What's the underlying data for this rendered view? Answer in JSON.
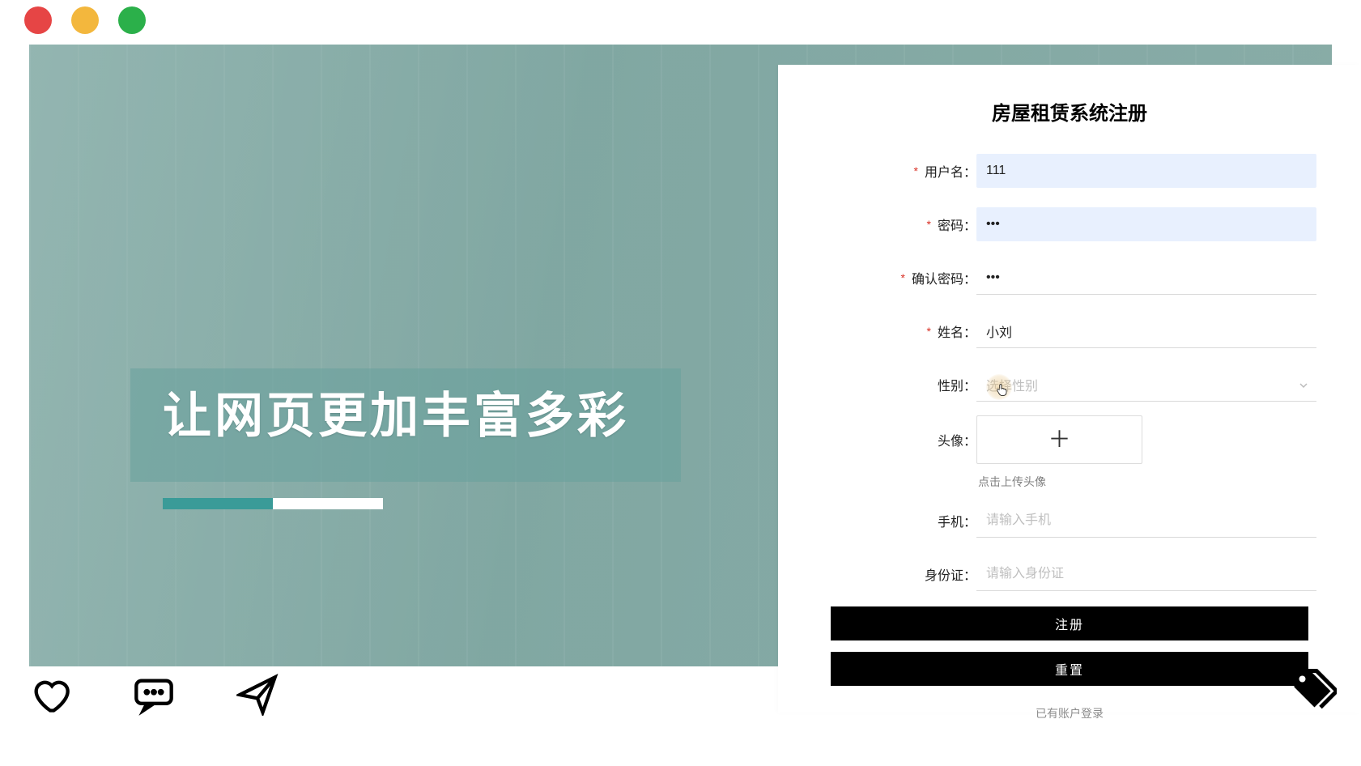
{
  "hero": {
    "headline": "让网页更加丰富多彩"
  },
  "form": {
    "title": "房屋租赁系统注册",
    "labels": {
      "username": "用户名：",
      "password": "密码：",
      "confirm": "确认密码：",
      "name": "姓名：",
      "gender": "性别：",
      "avatar": "头像：",
      "phone": "手机：",
      "idcard": "身份证："
    },
    "values": {
      "username": "111",
      "password": "•••",
      "confirm": "•••",
      "name": "小刘",
      "gender": ""
    },
    "placeholders": {
      "gender": "选择性别",
      "phone": "请输入手机",
      "idcard": "请输入身份证"
    },
    "upload_hint": "点击上传头像",
    "buttons": {
      "register": "注册",
      "reset": "重置"
    },
    "login_link": "已有账户登录"
  }
}
